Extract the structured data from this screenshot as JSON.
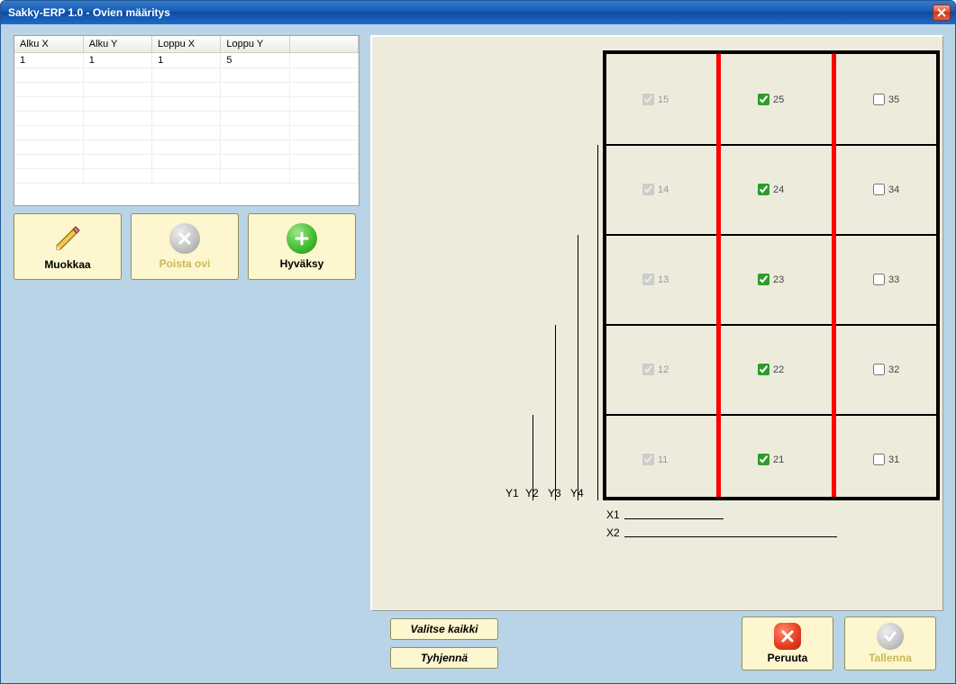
{
  "window": {
    "title": "Sakky-ERP 1.0 - Ovien määritys"
  },
  "grid": {
    "headers": [
      "Alku X",
      "Alku Y",
      "Loppu X",
      "Loppu Y"
    ],
    "rows": [
      {
        "ax": "1",
        "ay": "1",
        "lx": "1",
        "ly": "5"
      }
    ]
  },
  "buttons": {
    "edit": "Muokkaa",
    "delete": "Poista ovi",
    "accept": "Hyväksy",
    "selectAll": "Valitse kaikki",
    "clear": "Tyhjennä",
    "cancel": "Peruuta",
    "save": "Tallenna"
  },
  "cells": {
    "row5": {
      "c1": "15",
      "c2": "25",
      "c3": "35"
    },
    "row4": {
      "c1": "14",
      "c2": "24",
      "c3": "34"
    },
    "row3": {
      "c1": "13",
      "c2": "23",
      "c3": "33"
    },
    "row2": {
      "c1": "12",
      "c2": "22",
      "c3": "32"
    },
    "row1": {
      "c1": "11",
      "c2": "21",
      "c3": "31"
    }
  },
  "axes": {
    "y1": "Y1",
    "y2": "Y2",
    "y3": "Y3",
    "y4": "Y4",
    "x1": "X1",
    "x2": "X2"
  }
}
